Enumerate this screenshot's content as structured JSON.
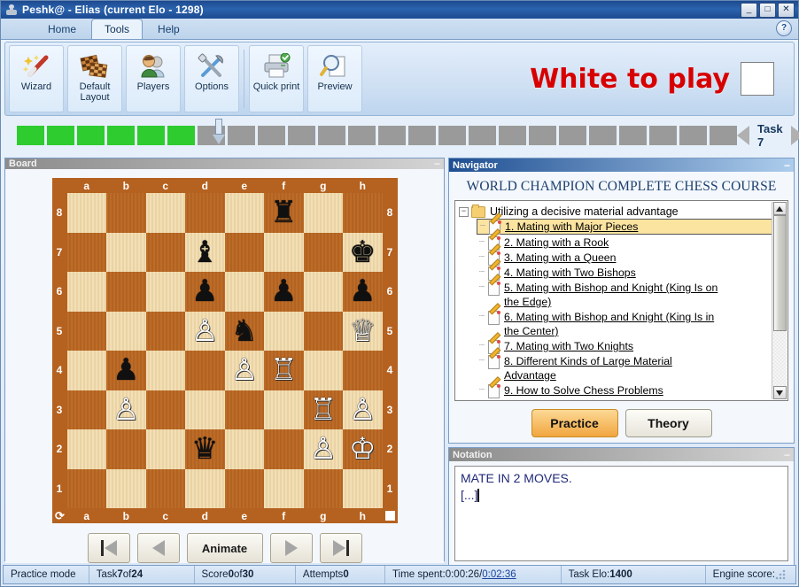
{
  "window": {
    "title": "Peshk@ -  Elias (current Elo - 1298)",
    "icon": "chess-pawn-icon",
    "minimize": "_",
    "maximize": "□",
    "close": "✕"
  },
  "ribbon": {
    "tabs": [
      {
        "label": "Home",
        "active": false
      },
      {
        "label": "Tools",
        "active": true
      },
      {
        "label": "Help",
        "active": false
      }
    ],
    "help_icon": "?",
    "buttons": [
      {
        "label": "Wizard",
        "icon": "magic-wand-icon"
      },
      {
        "label": "Default Layout",
        "icon": "checkerboard-layout-icon"
      },
      {
        "label": "Players",
        "icon": "players-icon"
      },
      {
        "label": "Options",
        "icon": "tools-wrench-screwdriver-icon"
      },
      {
        "label": "Quick print",
        "icon": "printer-check-icon"
      },
      {
        "label": "Preview",
        "icon": "magnifier-page-icon"
      }
    ],
    "status_message": "White to play",
    "status_message_color": "#d70000",
    "side_to_move_swatch": "#ffffff"
  },
  "task_strip": {
    "total_cells": 24,
    "completed_cells": 6,
    "current_cell": 7,
    "task_label": "Task 7",
    "prev_arrow": "left-arrow-icon",
    "next_arrow": "right-arrow-icon"
  },
  "board_panel": {
    "title": "Board",
    "minimize": "−",
    "files": [
      "a",
      "b",
      "c",
      "d",
      "e",
      "f",
      "g",
      "h"
    ],
    "ranks": [
      "8",
      "7",
      "6",
      "5",
      "4",
      "3",
      "2",
      "1"
    ],
    "flip_icon": "flip-board-icon",
    "position": [
      [
        "",
        "",
        "",
        "",
        "",
        "br",
        "",
        ""
      ],
      [
        "",
        "",
        "",
        "bb",
        "",
        "",
        "",
        "bk"
      ],
      [
        "",
        "",
        "",
        "bp",
        "",
        "bp",
        "",
        "bp"
      ],
      [
        "",
        "",
        "",
        "wp",
        "bn",
        "",
        "",
        "wq"
      ],
      [
        "",
        "bp",
        "",
        "",
        "wp",
        "wr",
        "",
        ""
      ],
      [
        "",
        "wp",
        "",
        "",
        "",
        "",
        "wr",
        "wp"
      ],
      [
        "",
        "",
        "",
        "bq",
        "",
        "",
        "wp",
        "wk"
      ],
      [
        "",
        "",
        "",
        "",
        "",
        "",
        "",
        ""
      ]
    ],
    "controls": [
      {
        "name": "first-move-button",
        "label": ""
      },
      {
        "name": "previous-move-button",
        "label": ""
      },
      {
        "name": "animate-button",
        "label": "Animate"
      },
      {
        "name": "next-move-button",
        "label": ""
      },
      {
        "name": "last-move-button",
        "label": ""
      }
    ]
  },
  "navigator": {
    "title": "Navigator",
    "minimize": "−",
    "course_title": "WORLD CHAMPION COMPLETE CHESS COURSE",
    "root": {
      "expander": "−",
      "label": "Utilizing a decisive material advantage"
    },
    "lessons": [
      {
        "label": "1. Mating with Major  Pieces ",
        "selected": true
      },
      {
        "label": "2. Mating with a Rook",
        "selected": false
      },
      {
        "label": "3. Mating with a Queen",
        "selected": false
      },
      {
        "label": "4. Mating with Two Bishops",
        "selected": false
      },
      {
        "label": "5. Mating with Bishop and Knight (King Is on the Edge)",
        "selected": false
      },
      {
        "label": "6. Mating with Bishop and Knight (King Is in the Center)",
        "selected": false
      },
      {
        "label": "7. Mating with Two Knights",
        "selected": false
      },
      {
        "label": "8. Different Kinds of  Large  Material Advantage",
        "selected": false
      },
      {
        "label": "9. How to Solve Chess Problems",
        "selected": false
      }
    ],
    "mode_buttons": [
      {
        "label": "Practice",
        "active": true
      },
      {
        "label": "Theory",
        "active": false
      }
    ]
  },
  "notation": {
    "title": "Notation",
    "minimize": "−",
    "line1": "MATE IN 2 MOVES.",
    "line2": "[...]"
  },
  "status_bar": {
    "mode": "Practice mode",
    "task_prefix": "Task ",
    "task_number": "7",
    "task_of": " of ",
    "task_total": "24",
    "score_prefix": "Score ",
    "score_value": "0",
    "score_of": " of ",
    "score_total": "30",
    "attempts_prefix": "Attempts ",
    "attempts_value": "0",
    "time_prefix": "Time spent: ",
    "time_elapsed": "0:00:26",
    "time_sep": " / ",
    "time_total": "0:02:36",
    "elo_prefix": "Task Elo: ",
    "elo_value": "1400",
    "engine_score": "Engine score:"
  }
}
